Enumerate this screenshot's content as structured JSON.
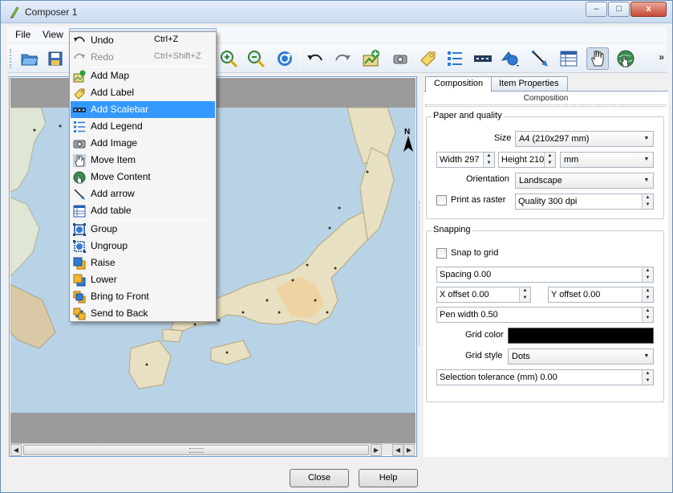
{
  "window": {
    "title": "Composer 1",
    "min": "–",
    "max": "□",
    "close": "x"
  },
  "menubar": {
    "file": "File",
    "view": "View"
  },
  "edit_menu": {
    "undo": {
      "label": "Undo",
      "shortcut": "Ctrl+Z"
    },
    "redo": {
      "label": "Redo",
      "shortcut": "Ctrl+Shift+Z"
    },
    "items": [
      "Add Map",
      "Add Label",
      "Add Scalebar",
      "Add Legend",
      "Add Image",
      "Move Item",
      "Move Content",
      "Add arrow",
      "Add table"
    ],
    "arrange": [
      "Group",
      "Ungroup",
      "Raise",
      "Lower",
      "Bring to Front",
      "Send to Back"
    ],
    "highlighted": "Add Scalebar"
  },
  "toolbar": {
    "overflow": "»"
  },
  "map": {
    "north_label": "N",
    "scroll_left": "◀",
    "scroll_right": "▶",
    "scroll_right2": "◀",
    "scroll_right3": "▶"
  },
  "tabs": {
    "composition": "Composition",
    "item_properties": "Item Properties"
  },
  "composition": {
    "header": "Composition",
    "paper": {
      "title": "Paper and quality",
      "size_label": "Size",
      "size_value": "A4 (210x297 mm)",
      "width": "Width 297",
      "height": "Height 210",
      "units": "mm",
      "orientation_label": "Orientation",
      "orientation_value": "Landscape",
      "print_as_raster": "Print as raster",
      "quality": "Quality 300 dpi"
    },
    "snapping": {
      "title": "Snapping",
      "snap_to_grid": "Snap to grid",
      "spacing": "Spacing 0.00",
      "x_offset": "X offset 0.00",
      "y_offset": "Y offset 0.00",
      "pen_width": "Pen width 0.50",
      "grid_color_label": "Grid color",
      "grid_color": "#000000",
      "grid_style_label": "Grid style",
      "grid_style": "Dots",
      "tolerance": "Selection tolerance (mm) 0.00"
    }
  },
  "buttons": {
    "close": "Close",
    "help": "Help"
  }
}
